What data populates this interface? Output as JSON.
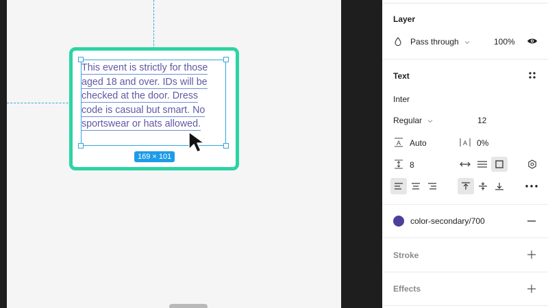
{
  "canvas": {
    "text_content": {
      "lines": [
        "This event is strictly for those",
        "aged 18 and over. IDs will be",
        "checked at the door. Dress",
        "code is casual but smart. No",
        "sportswear or hats allowed."
      ]
    },
    "size_badge": "169 × 101"
  },
  "panel": {
    "layer": {
      "title": "Layer",
      "blend_mode": "Pass through",
      "opacity": "100%"
    },
    "text": {
      "title": "Text",
      "font_family": "Inter",
      "font_weight": "Regular",
      "font_size": "12",
      "line_height": "Auto",
      "letter_spacing": "0%",
      "paragraph_spacing": "8"
    },
    "fill": {
      "style_name": "color-secondary/700",
      "color": "#4b3f9c"
    },
    "stroke": {
      "title": "Stroke"
    },
    "effects": {
      "title": "Effects"
    }
  }
}
